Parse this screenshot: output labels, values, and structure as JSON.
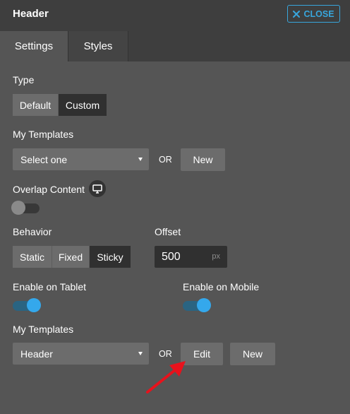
{
  "header": {
    "title": "Header",
    "close_label": "CLOSE"
  },
  "tabs": [
    {
      "label": "Settings",
      "active": true
    },
    {
      "label": "Styles",
      "active": false
    }
  ],
  "type": {
    "label": "Type",
    "options": [
      "Default",
      "Custom"
    ],
    "selected": "Custom"
  },
  "templates_top": {
    "label": "My Templates",
    "select_value": "Select one",
    "or_label": "OR",
    "new_label": "New"
  },
  "overlap": {
    "label": "Overlap Content",
    "icon": "monitor-icon",
    "enabled": false
  },
  "behavior": {
    "label": "Behavior",
    "options": [
      "Static",
      "Fixed",
      "Sticky"
    ],
    "selected": "Sticky"
  },
  "offset": {
    "label": "Offset",
    "value": "500",
    "unit": "px"
  },
  "tablet": {
    "label": "Enable on Tablet",
    "enabled": true
  },
  "mobile": {
    "label": "Enable on Mobile",
    "enabled": true
  },
  "templates_bottom": {
    "label": "My Templates",
    "select_value": "Header",
    "or_label": "OR",
    "edit_label": "Edit",
    "new_label": "New"
  },
  "colors": {
    "panel_bg": "#555555",
    "header_bg": "#3e3e3e",
    "accent": "#38a6dc",
    "toggle_on": "#34a8ec",
    "arrow": "#e8121c"
  }
}
